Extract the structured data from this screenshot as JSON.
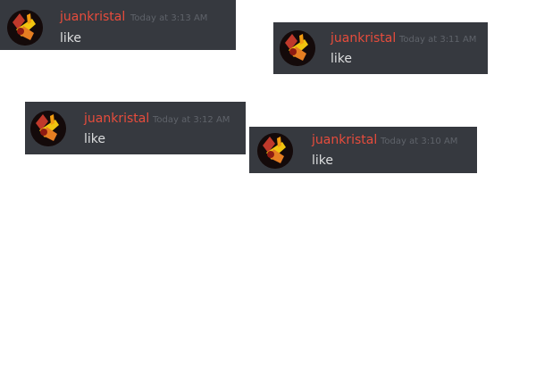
{
  "messages": [
    {
      "username": "juankristal",
      "timestamp": "Today at 3:13 AM",
      "content": "like"
    },
    {
      "username": "juankristal",
      "timestamp": "Today at 3:11 AM",
      "content": "like"
    },
    {
      "username": "juankristal",
      "timestamp": "Today at 3:12 AM",
      "content": "like"
    },
    {
      "username": "juankristal",
      "timestamp": "Today at 3:10 AM",
      "content": "like"
    }
  ],
  "colors": {
    "message_background": "#36393f",
    "username": "#e74c3c",
    "timestamp": "#5f636a",
    "content": "#dcddde"
  },
  "icons": {
    "avatar": "user-avatar-icon"
  }
}
